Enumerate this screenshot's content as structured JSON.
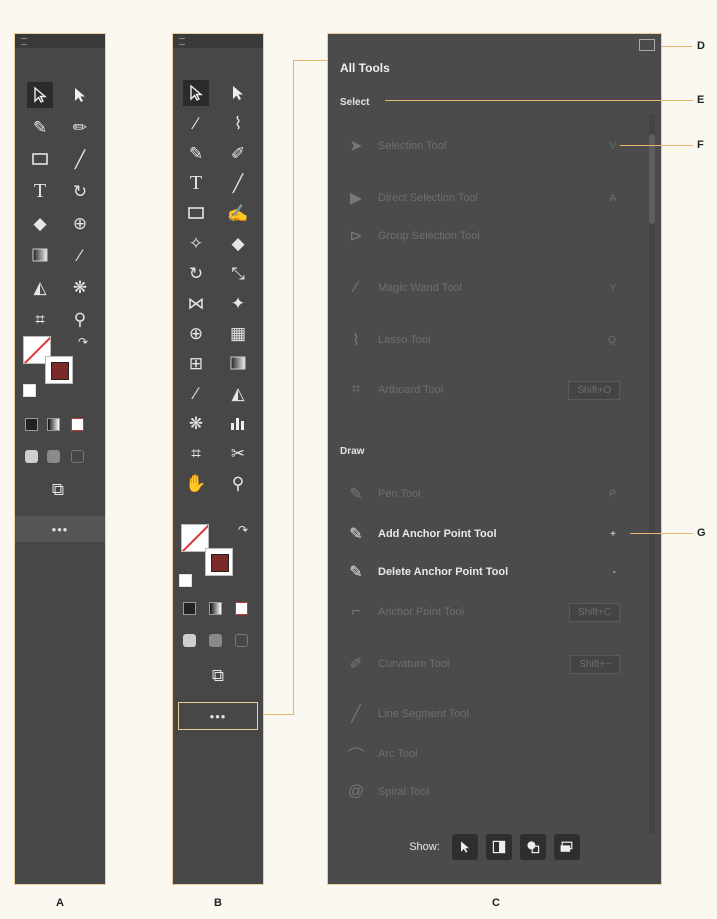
{
  "toolbar_a": {
    "more_label": "•••",
    "caption": "A"
  },
  "toolbar_b": {
    "more_label": "•••",
    "caption": "B"
  },
  "panel": {
    "title": "All Tools",
    "caption": "C",
    "sections": [
      {
        "label": "Select",
        "tools": [
          {
            "label": "Selection Tool",
            "shortcut": "V",
            "icon": "selection-arrow-icon",
            "active": false
          },
          {
            "label": "Direct Selection Tool",
            "shortcut": "A",
            "icon": "direct-selection-icon",
            "active": false
          },
          {
            "label": "Group Selection Tool",
            "shortcut": "",
            "icon": "group-selection-icon",
            "active": false
          },
          {
            "label": "Magic Wand Tool",
            "shortcut": "Y",
            "icon": "magic-wand-icon",
            "active": false
          },
          {
            "label": "Lasso Tool",
            "shortcut": "Q",
            "icon": "lasso-icon",
            "active": false
          },
          {
            "label": "Artboard Tool",
            "shortcut": "Shift+O",
            "icon": "artboard-icon",
            "active": false
          }
        ]
      },
      {
        "label": "Draw",
        "tools": [
          {
            "label": "Pen Tool",
            "shortcut": "P",
            "icon": "pen-icon",
            "active": false
          },
          {
            "label": "Add Anchor Point Tool",
            "shortcut": "+",
            "icon": "add-anchor-icon",
            "active": true
          },
          {
            "label": "Delete Anchor Point Tool",
            "shortcut": "-",
            "icon": "delete-anchor-icon",
            "active": true
          },
          {
            "label": "Anchor Point Tool",
            "shortcut": "Shift+C",
            "icon": "anchor-point-icon",
            "active": false
          },
          {
            "label": "Curvature Tool",
            "shortcut": "Shift+~",
            "icon": "curvature-icon",
            "active": false
          },
          {
            "label": "Line Segment Tool",
            "shortcut": "\\",
            "icon": "line-segment-icon",
            "active": false
          },
          {
            "label": "Arc Tool",
            "shortcut": "",
            "icon": "arc-icon",
            "active": false
          },
          {
            "label": "Spiral Tool",
            "shortcut": "",
            "icon": "spiral-icon",
            "active": false
          }
        ]
      }
    ],
    "show_label": "Show:"
  },
  "callouts": {
    "d": "D",
    "e": "E",
    "f": "F",
    "g": "G"
  },
  "colors": {
    "panel_bg": "#4b4b4b",
    "highlight_border": "#f0cc99",
    "callout_line": "#e8b36d"
  }
}
